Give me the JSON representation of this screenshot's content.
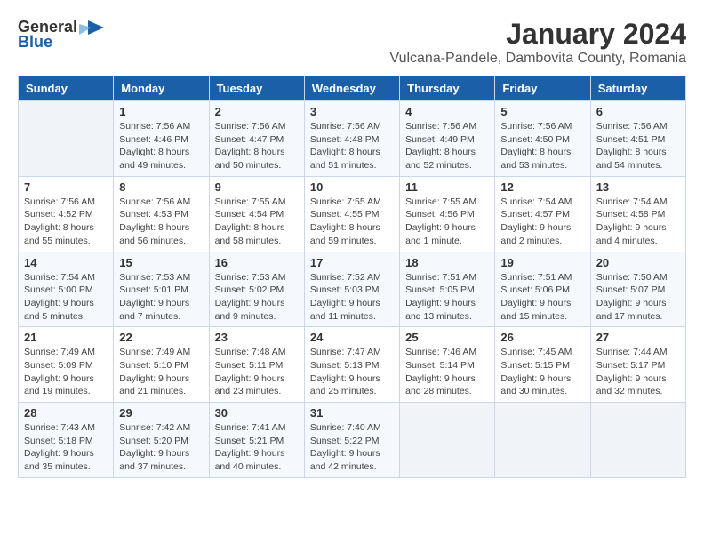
{
  "logo": {
    "general": "General",
    "blue": "Blue"
  },
  "title": "January 2024",
  "subtitle": "Vulcana-Pandele, Dambovita County, Romania",
  "days_of_week": [
    "Sunday",
    "Monday",
    "Tuesday",
    "Wednesday",
    "Thursday",
    "Friday",
    "Saturday"
  ],
  "weeks": [
    [
      {
        "day": "",
        "sunrise": "",
        "sunset": "",
        "daylight": ""
      },
      {
        "day": "1",
        "sunrise": "Sunrise: 7:56 AM",
        "sunset": "Sunset: 4:46 PM",
        "daylight": "Daylight: 8 hours and 49 minutes."
      },
      {
        "day": "2",
        "sunrise": "Sunrise: 7:56 AM",
        "sunset": "Sunset: 4:47 PM",
        "daylight": "Daylight: 8 hours and 50 minutes."
      },
      {
        "day": "3",
        "sunrise": "Sunrise: 7:56 AM",
        "sunset": "Sunset: 4:48 PM",
        "daylight": "Daylight: 8 hours and 51 minutes."
      },
      {
        "day": "4",
        "sunrise": "Sunrise: 7:56 AM",
        "sunset": "Sunset: 4:49 PM",
        "daylight": "Daylight: 8 hours and 52 minutes."
      },
      {
        "day": "5",
        "sunrise": "Sunrise: 7:56 AM",
        "sunset": "Sunset: 4:50 PM",
        "daylight": "Daylight: 8 hours and 53 minutes."
      },
      {
        "day": "6",
        "sunrise": "Sunrise: 7:56 AM",
        "sunset": "Sunset: 4:51 PM",
        "daylight": "Daylight: 8 hours and 54 minutes."
      }
    ],
    [
      {
        "day": "7",
        "sunrise": "Sunrise: 7:56 AM",
        "sunset": "Sunset: 4:52 PM",
        "daylight": "Daylight: 8 hours and 55 minutes."
      },
      {
        "day": "8",
        "sunrise": "Sunrise: 7:56 AM",
        "sunset": "Sunset: 4:53 PM",
        "daylight": "Daylight: 8 hours and 56 minutes."
      },
      {
        "day": "9",
        "sunrise": "Sunrise: 7:55 AM",
        "sunset": "Sunset: 4:54 PM",
        "daylight": "Daylight: 8 hours and 58 minutes."
      },
      {
        "day": "10",
        "sunrise": "Sunrise: 7:55 AM",
        "sunset": "Sunset: 4:55 PM",
        "daylight": "Daylight: 8 hours and 59 minutes."
      },
      {
        "day": "11",
        "sunrise": "Sunrise: 7:55 AM",
        "sunset": "Sunset: 4:56 PM",
        "daylight": "Daylight: 9 hours and 1 minute."
      },
      {
        "day": "12",
        "sunrise": "Sunrise: 7:54 AM",
        "sunset": "Sunset: 4:57 PM",
        "daylight": "Daylight: 9 hours and 2 minutes."
      },
      {
        "day": "13",
        "sunrise": "Sunrise: 7:54 AM",
        "sunset": "Sunset: 4:58 PM",
        "daylight": "Daylight: 9 hours and 4 minutes."
      }
    ],
    [
      {
        "day": "14",
        "sunrise": "Sunrise: 7:54 AM",
        "sunset": "Sunset: 5:00 PM",
        "daylight": "Daylight: 9 hours and 5 minutes."
      },
      {
        "day": "15",
        "sunrise": "Sunrise: 7:53 AM",
        "sunset": "Sunset: 5:01 PM",
        "daylight": "Daylight: 9 hours and 7 minutes."
      },
      {
        "day": "16",
        "sunrise": "Sunrise: 7:53 AM",
        "sunset": "Sunset: 5:02 PM",
        "daylight": "Daylight: 9 hours and 9 minutes."
      },
      {
        "day": "17",
        "sunrise": "Sunrise: 7:52 AM",
        "sunset": "Sunset: 5:03 PM",
        "daylight": "Daylight: 9 hours and 11 minutes."
      },
      {
        "day": "18",
        "sunrise": "Sunrise: 7:51 AM",
        "sunset": "Sunset: 5:05 PM",
        "daylight": "Daylight: 9 hours and 13 minutes."
      },
      {
        "day": "19",
        "sunrise": "Sunrise: 7:51 AM",
        "sunset": "Sunset: 5:06 PM",
        "daylight": "Daylight: 9 hours and 15 minutes."
      },
      {
        "day": "20",
        "sunrise": "Sunrise: 7:50 AM",
        "sunset": "Sunset: 5:07 PM",
        "daylight": "Daylight: 9 hours and 17 minutes."
      }
    ],
    [
      {
        "day": "21",
        "sunrise": "Sunrise: 7:49 AM",
        "sunset": "Sunset: 5:09 PM",
        "daylight": "Daylight: 9 hours and 19 minutes."
      },
      {
        "day": "22",
        "sunrise": "Sunrise: 7:49 AM",
        "sunset": "Sunset: 5:10 PM",
        "daylight": "Daylight: 9 hours and 21 minutes."
      },
      {
        "day": "23",
        "sunrise": "Sunrise: 7:48 AM",
        "sunset": "Sunset: 5:11 PM",
        "daylight": "Daylight: 9 hours and 23 minutes."
      },
      {
        "day": "24",
        "sunrise": "Sunrise: 7:47 AM",
        "sunset": "Sunset: 5:13 PM",
        "daylight": "Daylight: 9 hours and 25 minutes."
      },
      {
        "day": "25",
        "sunrise": "Sunrise: 7:46 AM",
        "sunset": "Sunset: 5:14 PM",
        "daylight": "Daylight: 9 hours and 28 minutes."
      },
      {
        "day": "26",
        "sunrise": "Sunrise: 7:45 AM",
        "sunset": "Sunset: 5:15 PM",
        "daylight": "Daylight: 9 hours and 30 minutes."
      },
      {
        "day": "27",
        "sunrise": "Sunrise: 7:44 AM",
        "sunset": "Sunset: 5:17 PM",
        "daylight": "Daylight: 9 hours and 32 minutes."
      }
    ],
    [
      {
        "day": "28",
        "sunrise": "Sunrise: 7:43 AM",
        "sunset": "Sunset: 5:18 PM",
        "daylight": "Daylight: 9 hours and 35 minutes."
      },
      {
        "day": "29",
        "sunrise": "Sunrise: 7:42 AM",
        "sunset": "Sunset: 5:20 PM",
        "daylight": "Daylight: 9 hours and 37 minutes."
      },
      {
        "day": "30",
        "sunrise": "Sunrise: 7:41 AM",
        "sunset": "Sunset: 5:21 PM",
        "daylight": "Daylight: 9 hours and 40 minutes."
      },
      {
        "day": "31",
        "sunrise": "Sunrise: 7:40 AM",
        "sunset": "Sunset: 5:22 PM",
        "daylight": "Daylight: 9 hours and 42 minutes."
      },
      {
        "day": "",
        "sunrise": "",
        "sunset": "",
        "daylight": ""
      },
      {
        "day": "",
        "sunrise": "",
        "sunset": "",
        "daylight": ""
      },
      {
        "day": "",
        "sunrise": "",
        "sunset": "",
        "daylight": ""
      }
    ]
  ]
}
